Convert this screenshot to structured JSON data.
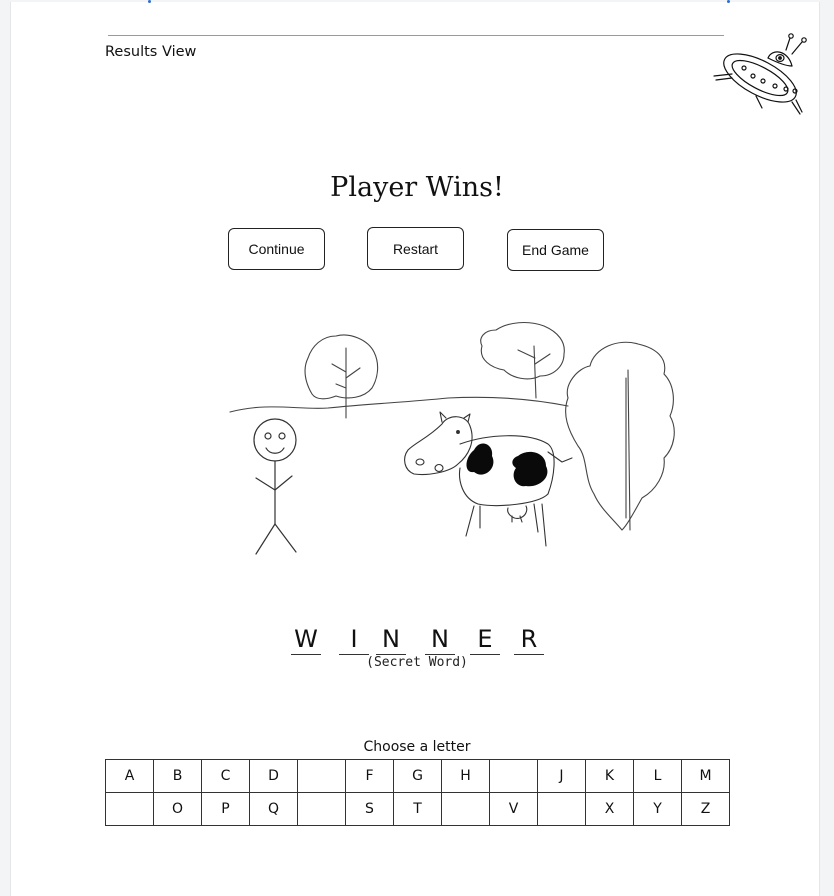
{
  "header": {
    "view_title": "Results View"
  },
  "result": {
    "title": "Player Wins!"
  },
  "buttons": {
    "continue_label": "Continue",
    "restart_label": "Restart",
    "end_game_label": "End Game"
  },
  "secret_word": {
    "letters": [
      "W",
      "I",
      "N",
      "N",
      "E",
      "R"
    ],
    "label": "(Secret Word)"
  },
  "letter_picker": {
    "prompt": "Choose a letter",
    "rows": [
      [
        "A",
        "B",
        "C",
        "D",
        "",
        "F",
        "G",
        "H",
        "",
        "J",
        "K",
        "L",
        "M"
      ],
      [
        "",
        "O",
        "P",
        "Q",
        "",
        "S",
        "T",
        "",
        "V",
        "",
        "X",
        "Y",
        "Z"
      ]
    ]
  },
  "icons": {
    "ufo": "ufo-sketch-icon"
  }
}
